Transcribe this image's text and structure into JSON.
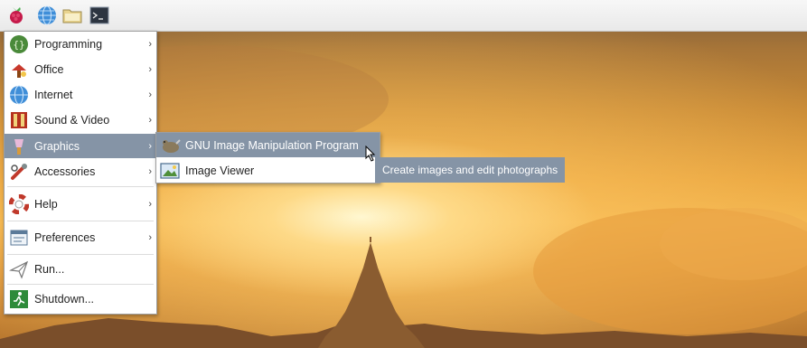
{
  "menu": {
    "items": [
      {
        "label": "Programming",
        "icon": "programming-icon",
        "submenu": true
      },
      {
        "label": "Office",
        "icon": "office-icon",
        "submenu": true
      },
      {
        "label": "Internet",
        "icon": "internet-globe-icon",
        "submenu": true
      },
      {
        "label": "Sound & Video",
        "icon": "sound-video-icon",
        "submenu": true
      },
      {
        "label": "Graphics",
        "icon": "graphics-icon",
        "submenu": true,
        "active": true
      },
      {
        "label": "Accessories",
        "icon": "accessories-icon",
        "submenu": true
      },
      {
        "label": "Help",
        "icon": "help-lifebuoy-icon",
        "submenu": true
      },
      {
        "label": "Preferences",
        "icon": "preferences-icon",
        "submenu": true
      },
      {
        "label": "Run...",
        "icon": "run-paper-plane-icon",
        "submenu": false
      },
      {
        "label": "Shutdown...",
        "icon": "shutdown-exit-icon",
        "submenu": false
      }
    ],
    "arrow": "›"
  },
  "submenu": {
    "items": [
      {
        "label": "GNU Image Manipulation Program",
        "icon": "gimp-icon",
        "active": true
      },
      {
        "label": "Image Viewer",
        "icon": "image-viewer-icon"
      }
    ]
  },
  "tooltip": {
    "text": "Create images and edit photographs"
  },
  "taskbar": {
    "launchers": [
      "raspberry-menu-icon",
      "web-browser-globe-icon",
      "file-manager-folder-icon",
      "terminal-icon"
    ],
    "terminal_prompt": ">_"
  },
  "colors": {
    "highlight": "#8594a6",
    "panel": "#eeeeee",
    "sky_glow": "#f1b34c"
  }
}
